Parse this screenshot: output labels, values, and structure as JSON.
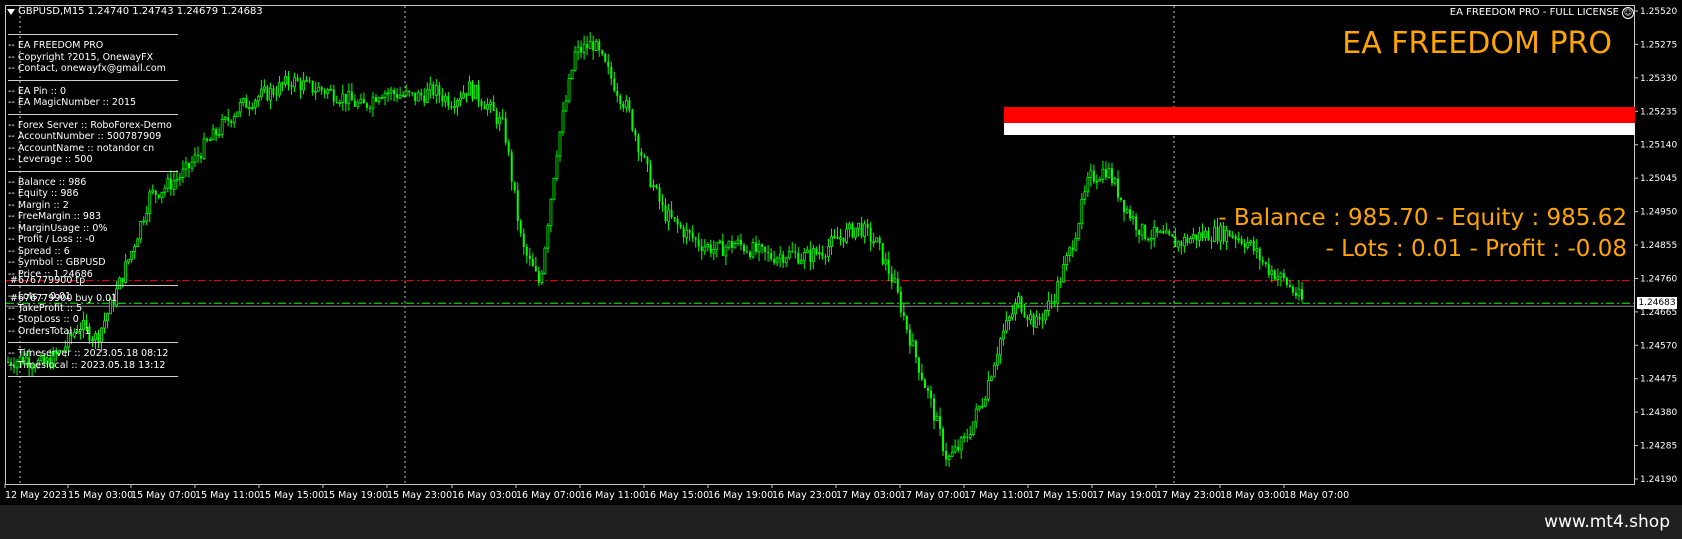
{
  "header": {
    "symbol": "GBPUSD,M15  1.24740 1.24743 1.24679 1.24683",
    "license": "EA FREEDOM PRO - FULL LICENSE",
    "title": "EA FREEDOM PRO"
  },
  "stats": {
    "line1": "- Balance : 985.70 - Equity : 985.62",
    "line2": "- Lots : 0.01 - Profit : -0.08"
  },
  "info_panel": {
    "sections": [
      [
        "-- EA FREEDOM PRO",
        "-- Copyright ?2015, OnewayFX",
        "-- Contact, onewayfx@gmail.com"
      ],
      [
        "-- EA Pin :: 0",
        "-- EA MagicNumber :: 2015"
      ],
      [
        "-- Forex Server :: RoboForex-Demo",
        "-- AccountNumber :: 500787909",
        "-- AccountName :: notandor cn",
        "-- Leverage :: 500"
      ],
      [
        "-- Balance :: 986",
        "-- Equity :: 986",
        "-- Margin :: 2",
        "-- FreeMargin :: 983",
        "-- MarginUsage :: 0%",
        "-- Profit / Loss :: -0",
        "-- Spread :: 6",
        "-- Symbol :: GBPUSD",
        "-- Price :: 1.24686"
      ],
      [
        "-- Lots :: 0.01",
        "-- TakeProfit :: 5",
        "-- StopLoss :: 0",
        "-- OrdersTotal :: 1"
      ],
      [
        "-- Timeserver :: 2023.05.18 08:12",
        "-- Timeslocal :: 2023.05.18 13:12"
      ]
    ]
  },
  "order_labels": {
    "tp": "#676779900 tp",
    "buy": "#676779900 buy 0.01"
  },
  "footer": {
    "url": "www.mt4.shop"
  },
  "current_price_tag": "1.24683",
  "chart_data": {
    "type": "candlestick",
    "symbol": "GBPUSD",
    "timeframe": "M15",
    "ylim": [
      1.2415,
      1.2556
    ],
    "yticks": [
      "1.25520",
      "1.25275",
      "1.25330",
      "1.25235",
      "1.25140",
      "1.25045",
      "1.24950",
      "1.24855",
      "1.24760",
      "1.24665",
      "1.24570",
      "1.24475",
      "1.24380",
      "1.24285",
      "1.24190"
    ],
    "xticks": [
      "12 May 2023",
      "15 May 03:00",
      "15 May 07:00",
      "15 May 11:00",
      "15 May 15:00",
      "15 May 19:00",
      "15 May 23:00",
      "16 May 03:00",
      "16 May 07:00",
      "16 May 11:00",
      "16 May 15:00",
      "16 May 19:00",
      "16 May 23:00",
      "17 May 03:00",
      "17 May 07:00",
      "17 May 11:00",
      "17 May 15:00",
      "17 May 19:00",
      "17 May 23:00",
      "18 May 03:00",
      "18 May 07:00"
    ],
    "price_path": [
      1.2451,
      1.2452,
      1.245,
      1.2454,
      1.2462,
      1.2458,
      1.247,
      1.2484,
      1.25,
      1.2503,
      1.2507,
      1.2514,
      1.252,
      1.2526,
      1.2529,
      1.2531,
      1.2534,
      1.2532,
      1.2531,
      1.2529,
      1.2526,
      1.2531,
      1.253,
      1.2529,
      1.2531,
      1.2528,
      1.2532,
      1.2527,
      1.252,
      1.2485,
      1.2474,
      1.2515,
      1.2542,
      1.2545,
      1.2535,
      1.2525,
      1.2508,
      1.2495,
      1.249,
      1.2486,
      1.2484,
      1.2486,
      1.2484,
      1.2482,
      1.2483,
      1.2482,
      1.2484,
      1.2488,
      1.2491,
      1.2486,
      1.2474,
      1.2456,
      1.244,
      1.2422,
      1.2428,
      1.244,
      1.2458,
      1.2469,
      1.2462,
      1.247,
      1.2485,
      1.2505,
      1.2508,
      1.2497,
      1.2489,
      1.2488,
      1.2486,
      1.2488,
      1.2489,
      1.2489,
      1.2486,
      1.2479,
      1.2475,
      1.2469
    ],
    "tp_line": 1.2475,
    "bid_line": 1.24683,
    "current_price": 1.24683,
    "colors": {
      "bull": "#00ff00",
      "bear": "#00ff00",
      "tp": "#ff0000",
      "bid": "#00ff00",
      "grid": "#c8c8c8"
    }
  }
}
